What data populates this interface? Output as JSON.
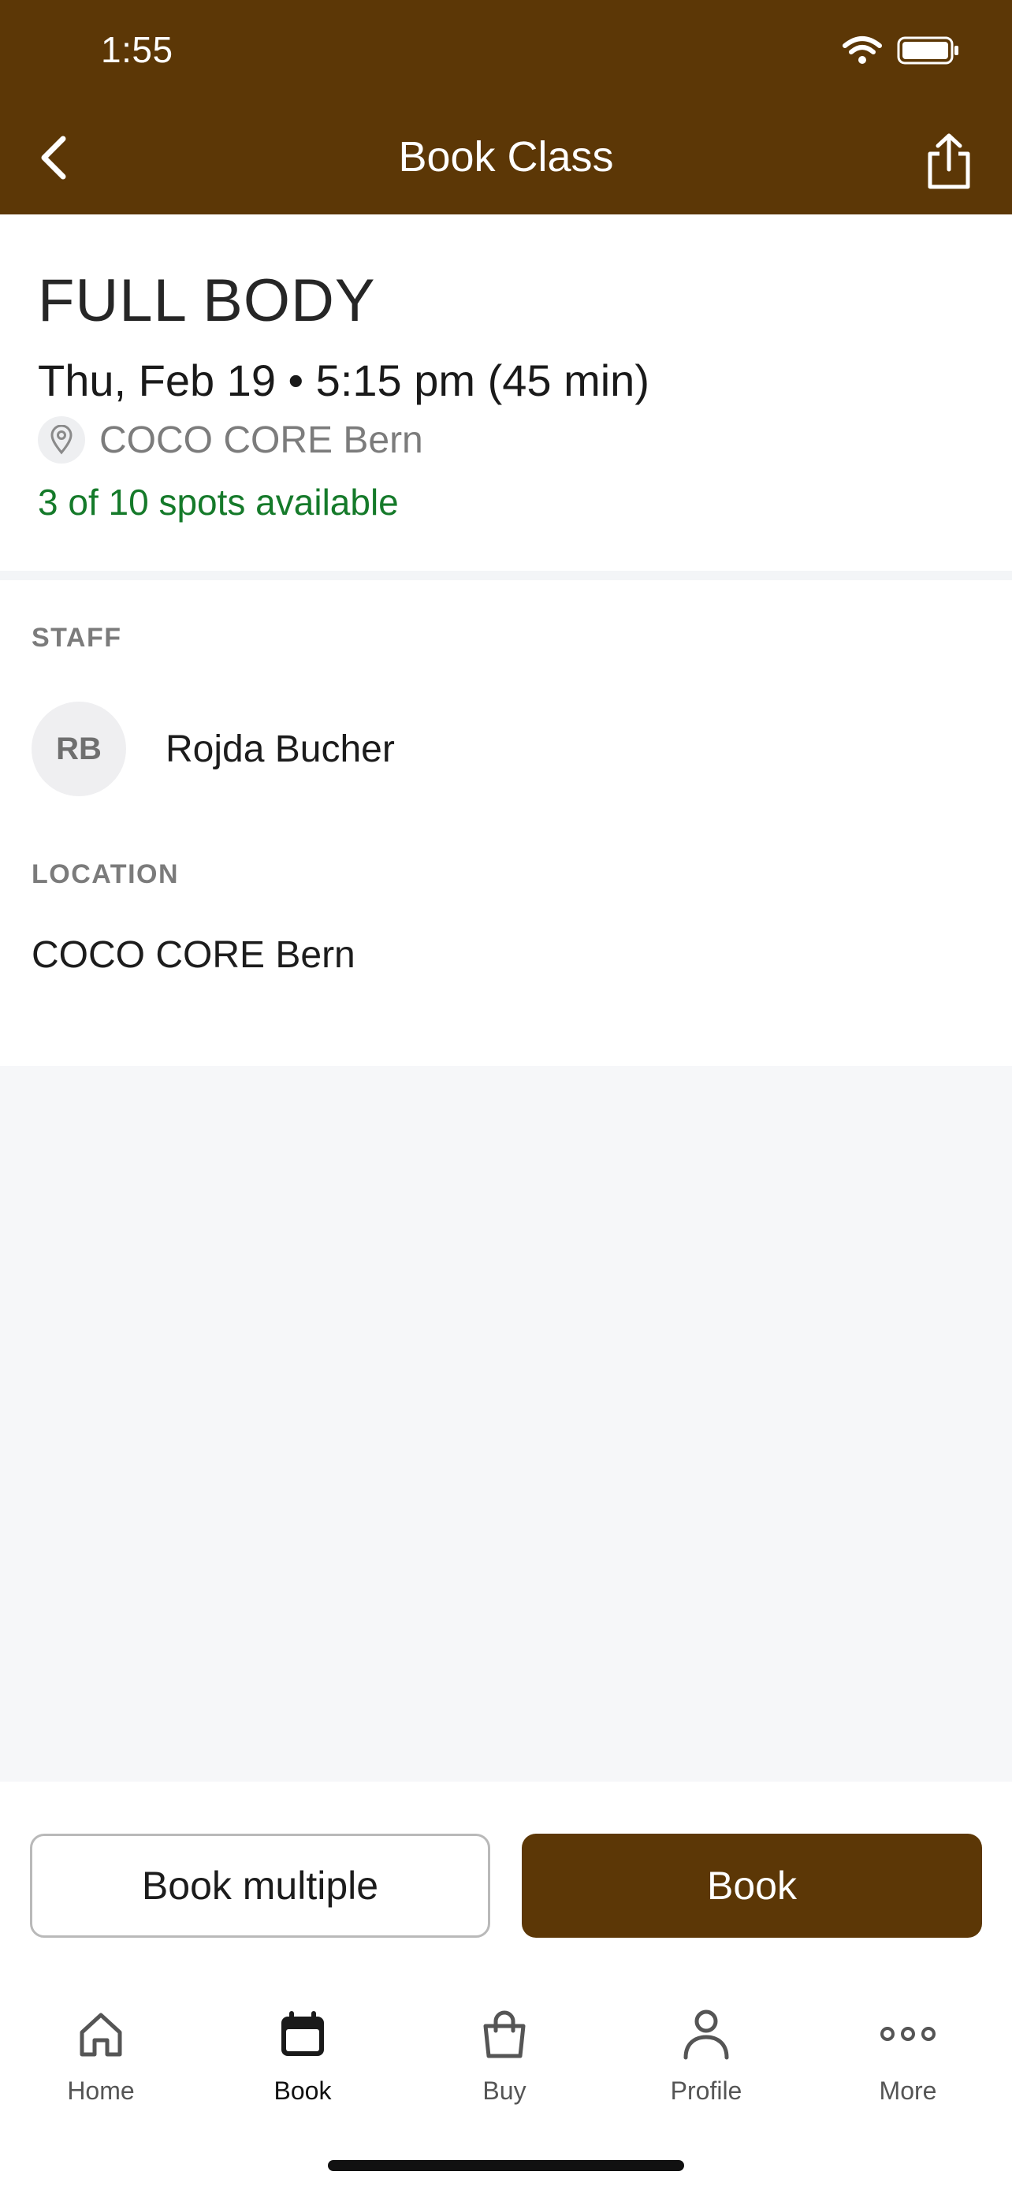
{
  "status_bar": {
    "time": "1:55"
  },
  "header": {
    "title": "Book Class"
  },
  "class": {
    "name": "FULL BODY",
    "datetime": "Thu, Feb 19 • 5:15 pm (45 min)",
    "location": "COCO CORE Bern",
    "spots": "3 of 10 spots available"
  },
  "staff": {
    "label": "STAFF",
    "initials": "RB",
    "name": "Rojda Bucher"
  },
  "location": {
    "label": "LOCATION",
    "value": "COCO CORE Bern"
  },
  "actions": {
    "book_multiple": "Book multiple",
    "book": "Book"
  },
  "tabs": [
    {
      "label": "Home",
      "icon": "home-icon"
    },
    {
      "label": "Book",
      "icon": "calendar-icon"
    },
    {
      "label": "Buy",
      "icon": "shopping-bag-icon"
    },
    {
      "label": "Profile",
      "icon": "person-icon"
    },
    {
      "label": "More",
      "icon": "more-icon"
    }
  ],
  "colors": {
    "brand": "#5c3706",
    "available": "#157a2a"
  }
}
